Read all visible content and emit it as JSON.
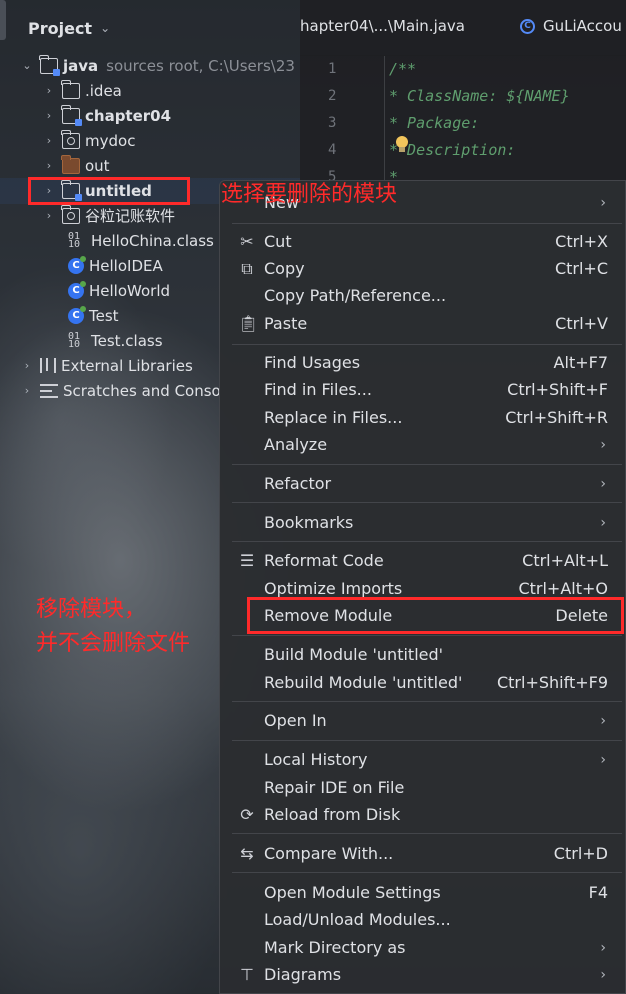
{
  "project_panel": {
    "title": "Project"
  },
  "editor": {
    "tabs": [
      "hapter04\\...\\Main.java",
      "GuLiAccou"
    ],
    "line_numbers": [
      "1",
      "2",
      "3",
      "4",
      "5"
    ],
    "code_lines": [
      "/**",
      " * ClassName: ${NAME}",
      " * Package:",
      " * Description:",
      " *"
    ]
  },
  "tree": {
    "root": {
      "name": "java",
      "hint": "sources root,  C:\\Users\\23"
    },
    "items": [
      {
        "name": ".idea"
      },
      {
        "name": "chapter04"
      },
      {
        "name": "mydoc"
      },
      {
        "name": "out"
      },
      {
        "name": "untitled"
      },
      {
        "name": "谷粒记账软件"
      },
      {
        "name": "HelloChina.class"
      },
      {
        "name": "HelloIDEA"
      },
      {
        "name": "HelloWorld"
      },
      {
        "name": "Test"
      },
      {
        "name": "Test.class"
      }
    ],
    "external_libraries": "External Libraries",
    "scratches": "Scratches and Conso"
  },
  "annotations": {
    "select_module": "选择要删除的模块",
    "remove_note_line1": "移除模块，",
    "remove_note_line2": "并不会删除文件"
  },
  "menu": {
    "items": [
      {
        "label": "New",
        "shortcut": "",
        "submenu": true
      },
      {
        "label": "Cut",
        "shortcut": "Ctrl+X"
      },
      {
        "label": "Copy",
        "shortcut": "Ctrl+C"
      },
      {
        "label": "Copy Path/Reference...",
        "shortcut": ""
      },
      {
        "label": "Paste",
        "shortcut": "Ctrl+V"
      },
      {
        "label": "Find Usages",
        "shortcut": "Alt+F7"
      },
      {
        "label": "Find in Files...",
        "shortcut": "Ctrl+Shift+F"
      },
      {
        "label": "Replace in Files...",
        "shortcut": "Ctrl+Shift+R"
      },
      {
        "label": "Analyze",
        "shortcut": "",
        "submenu": true
      },
      {
        "label": "Refactor",
        "shortcut": "",
        "submenu": true
      },
      {
        "label": "Bookmarks",
        "shortcut": "",
        "submenu": true
      },
      {
        "label": "Reformat Code",
        "shortcut": "Ctrl+Alt+L"
      },
      {
        "label": "Optimize Imports",
        "shortcut": "Ctrl+Alt+O"
      },
      {
        "label": "Remove Module",
        "shortcut": "Delete"
      },
      {
        "label": "Build Module 'untitled'",
        "shortcut": ""
      },
      {
        "label": "Rebuild Module 'untitled'",
        "shortcut": "Ctrl+Shift+F9"
      },
      {
        "label": "Open In",
        "shortcut": "",
        "submenu": true
      },
      {
        "label": "Local History",
        "shortcut": "",
        "submenu": true
      },
      {
        "label": "Repair IDE on File",
        "shortcut": ""
      },
      {
        "label": "Reload from Disk",
        "shortcut": ""
      },
      {
        "label": "Compare With...",
        "shortcut": "Ctrl+D"
      },
      {
        "label": "Open Module Settings",
        "shortcut": "F4"
      },
      {
        "label": "Load/Unload Modules...",
        "shortcut": ""
      },
      {
        "label": "Mark Directory as",
        "shortcut": "",
        "submenu": true
      },
      {
        "label": "Diagrams",
        "shortcut": "",
        "submenu": true
      }
    ]
  }
}
